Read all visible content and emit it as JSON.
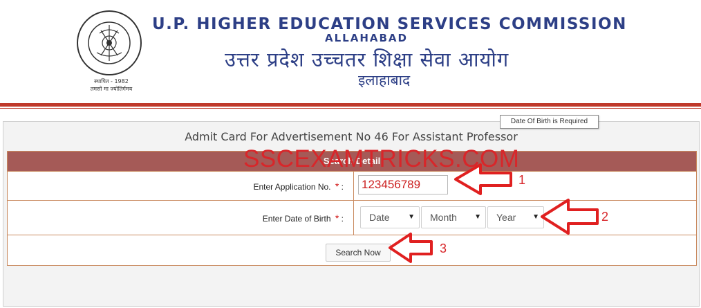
{
  "header": {
    "title_en": "U.P. HIGHER EDUCATION SERVICES COMMISSION",
    "subtitle_en": "ALLAHABAD",
    "title_hi": "उत्तर प्रदेश उच्चतर शिक्षा सेवा आयोग",
    "subtitle_hi": "इलाहाबाद",
    "seal_year": "स्थापित - 1982",
    "seal_motto": "तमसो मा ज्योतिर्गमय",
    "accent_color": "#c0392b",
    "title_color": "#2d3f86"
  },
  "panel": {
    "title": "Admit Card For Advertisement No 46 For Assistant Professor",
    "section_head": "Search Detail",
    "application_label": "Enter Application No.",
    "application_value": "123456789",
    "dob_label": "Enter Date of Birth",
    "required_mark": "*",
    "colon": ":",
    "date_select": "Date",
    "month_select": "Month",
    "year_select": "Year",
    "search_button": "Search Now",
    "tooltip": "Date Of Birth is Required"
  },
  "annotations": {
    "step1": "1",
    "step2": "2",
    "step3": "3",
    "watermark": "SSCEXAMTRICKS.COM"
  }
}
